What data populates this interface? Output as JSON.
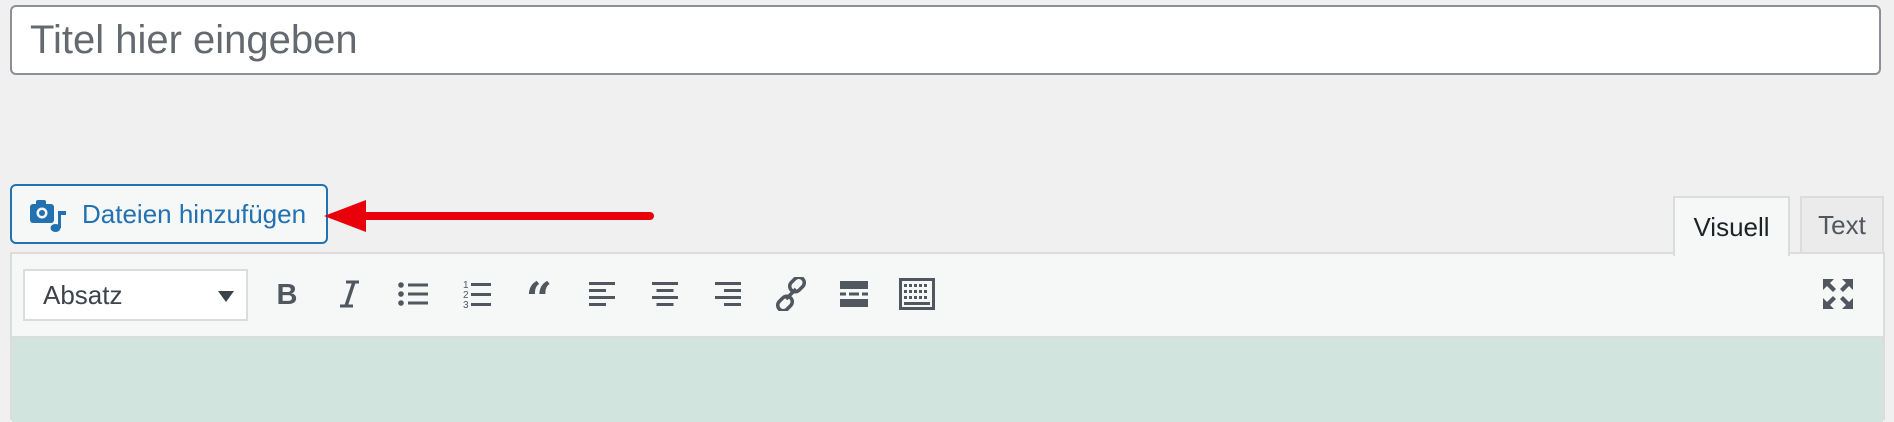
{
  "title_field": {
    "placeholder": "Titel hier eingeben",
    "value": ""
  },
  "media_button": {
    "label": "Dateien hinzufügen",
    "icon": "add-media-icon"
  },
  "tabs": [
    {
      "label": "Visuell",
      "active": true
    },
    {
      "label": "Text",
      "active": false
    }
  ],
  "toolbar": {
    "format_select": {
      "selected": "Absatz"
    },
    "buttons": [
      {
        "name": "bold",
        "icon": "bold-icon"
      },
      {
        "name": "italic",
        "icon": "italic-icon"
      },
      {
        "name": "bullet-list",
        "icon": "bullet-list-icon"
      },
      {
        "name": "numbered-list",
        "icon": "numbered-list-icon"
      },
      {
        "name": "blockquote",
        "icon": "quote-icon"
      },
      {
        "name": "align-left",
        "icon": "align-left-icon"
      },
      {
        "name": "align-center",
        "icon": "align-center-icon"
      },
      {
        "name": "align-right",
        "icon": "align-right-icon"
      },
      {
        "name": "insert-link",
        "icon": "link-icon"
      },
      {
        "name": "read-more",
        "icon": "read-more-icon"
      },
      {
        "name": "toolbar-toggle",
        "icon": "keyboard-icon"
      },
      {
        "name": "distraction-free",
        "icon": "fullscreen-icon"
      }
    ]
  },
  "colors": {
    "background": "#f0f0f1",
    "accent_blue": "#2271b1",
    "annotation_arrow": "#e8000b",
    "editor_content": "#d1e4dd",
    "icon": "#50575e"
  }
}
